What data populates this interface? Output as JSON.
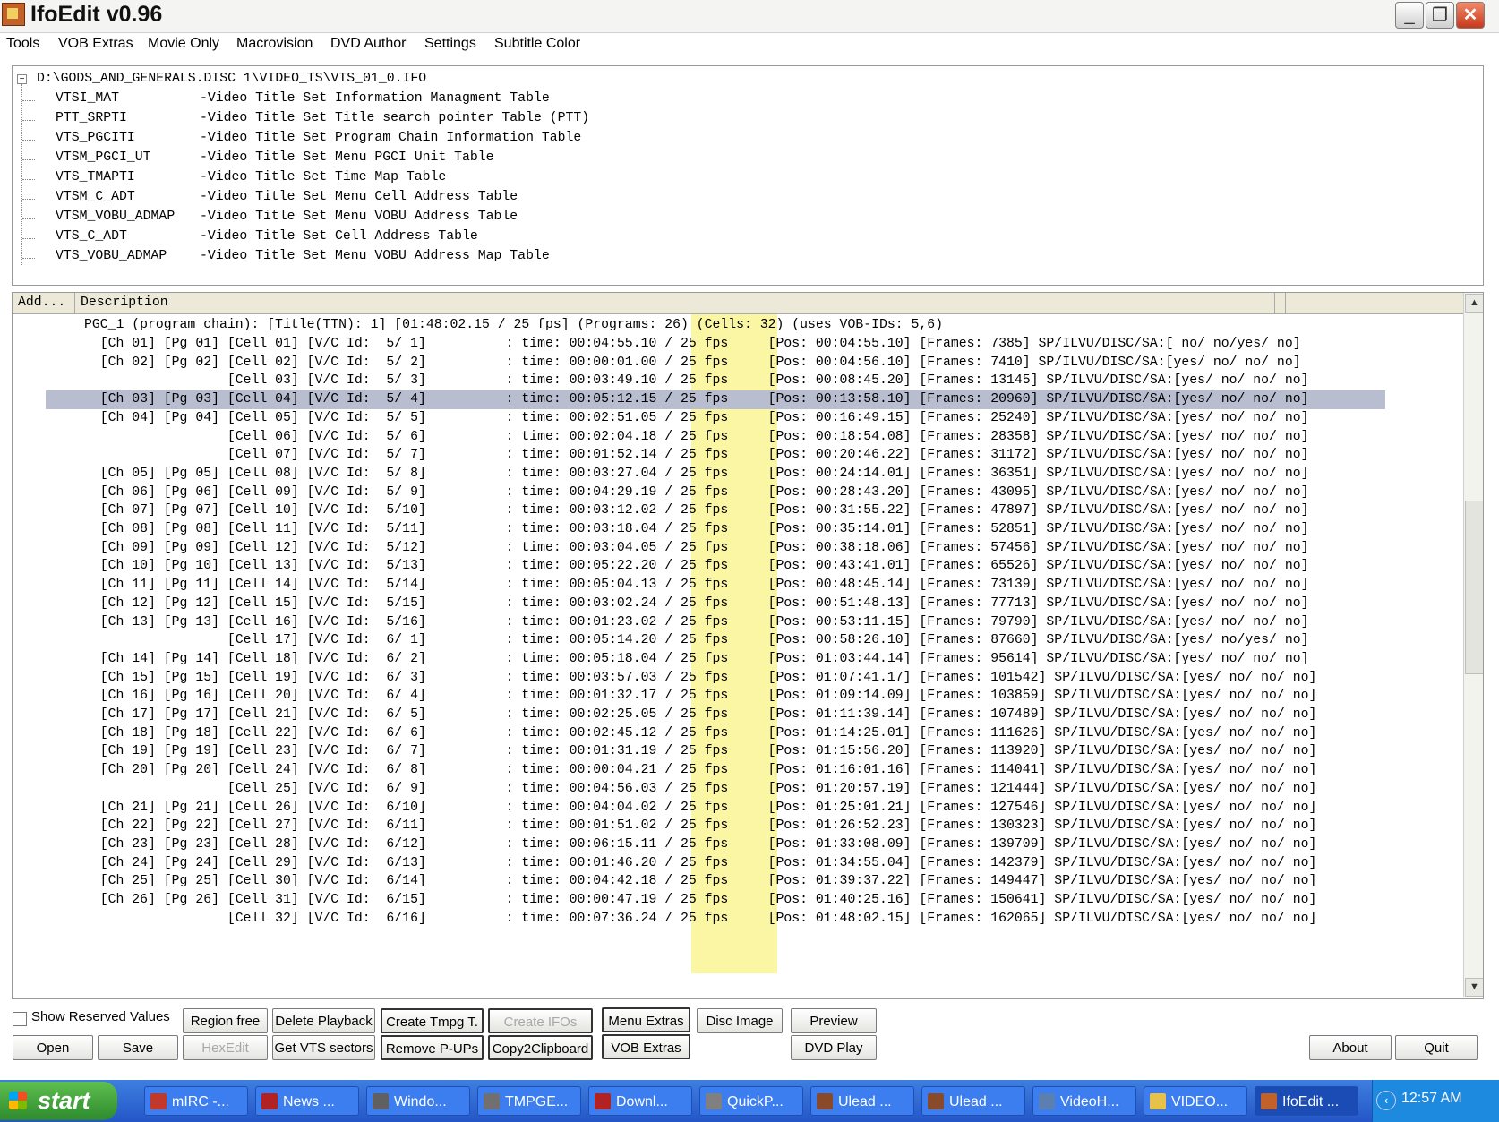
{
  "window": {
    "title": "IfoEdit v0.96",
    "minimize_glyph": "_",
    "maximize_glyph": "❐",
    "close_glyph": "✕"
  },
  "menu": [
    "Tools",
    "VOB Extras",
    "Movie Only",
    "Macrovision",
    "DVD Author",
    "Settings",
    "Subtitle Color"
  ],
  "tree": {
    "toggle": "−",
    "root": "D:\\GODS_AND_GENERALS.DISC 1\\VIDEO_TS\\VTS_01_0.IFO",
    "items": [
      {
        "name": "VTSI_MAT",
        "desc": "-Video Title Set Information Managment Table"
      },
      {
        "name": "PTT_SRPTI",
        "desc": "-Video Title Set Title search pointer Table (PTT)"
      },
      {
        "name": "VTS_PGCITI",
        "desc": "-Video Title Set Program Chain Information Table"
      },
      {
        "name": "VTSM_PGCI_UT",
        "desc": "-Video Title Set Menu PGCI Unit Table"
      },
      {
        "name": "VTS_TMAPTI",
        "desc": "-Video Title Set Time Map Table"
      },
      {
        "name": "VTSM_C_ADT",
        "desc": "-Video Title Set Menu Cell Address Table"
      },
      {
        "name": "VTSM_VOBU_ADMAP",
        "desc": "-Video Title Set Menu VOBU Address Table"
      },
      {
        "name": "VTS_C_ADT",
        "desc": "-Video Title Set Cell Address Table"
      },
      {
        "name": "VTS_VOBU_ADMAP",
        "desc": "-Video Title Set Menu VOBU Address Map Table"
      }
    ]
  },
  "list": {
    "headers": [
      "Add...",
      "Description"
    ],
    "pgc_header": "PGC_1 (program chain): [Title(TTN): 1] [01:48:02.15 / 25 fps] (Programs: 26) (Cells: 32) (uses VOB-IDs: 5,6)",
    "rows": [
      "  [Ch 01] [Pg 01] [Cell 01] [V/C Id:  5/ 1]          : time: 00:04:55.10 / 25 fps     [Pos: 00:04:55.10] [Frames: 7385] SP/ILVU/DISC/SA:[ no/ no/yes/ no]",
      "  [Ch 02] [Pg 02] [Cell 02] [V/C Id:  5/ 2]          : time: 00:00:01.00 / 25 fps     [Pos: 00:04:56.10] [Frames: 7410] SP/ILVU/DISC/SA:[yes/ no/ no/ no]",
      "                  [Cell 03] [V/C Id:  5/ 3]          : time: 00:03:49.10 / 25 fps     [Pos: 00:08:45.20] [Frames: 13145] SP/ILVU/DISC/SA:[yes/ no/ no/ no]",
      "  [Ch 03] [Pg 03] [Cell 04] [V/C Id:  5/ 4]          : time: 00:05:12.15 / 25 fps     [Pos: 00:13:58.10] [Frames: 20960] SP/ILVU/DISC/SA:[yes/ no/ no/ no]",
      "  [Ch 04] [Pg 04] [Cell 05] [V/C Id:  5/ 5]          : time: 00:02:51.05 / 25 fps     [Pos: 00:16:49.15] [Frames: 25240] SP/ILVU/DISC/SA:[yes/ no/ no/ no]",
      "                  [Cell 06] [V/C Id:  5/ 6]          : time: 00:02:04.18 / 25 fps     [Pos: 00:18:54.08] [Frames: 28358] SP/ILVU/DISC/SA:[yes/ no/ no/ no]",
      "                  [Cell 07] [V/C Id:  5/ 7]          : time: 00:01:52.14 / 25 fps     [Pos: 00:20:46.22] [Frames: 31172] SP/ILVU/DISC/SA:[yes/ no/ no/ no]",
      "  [Ch 05] [Pg 05] [Cell 08] [V/C Id:  5/ 8]          : time: 00:03:27.04 / 25 fps     [Pos: 00:24:14.01] [Frames: 36351] SP/ILVU/DISC/SA:[yes/ no/ no/ no]",
      "  [Ch 06] [Pg 06] [Cell 09] [V/C Id:  5/ 9]          : time: 00:04:29.19 / 25 fps     [Pos: 00:28:43.20] [Frames: 43095] SP/ILVU/DISC/SA:[yes/ no/ no/ no]",
      "  [Ch 07] [Pg 07] [Cell 10] [V/C Id:  5/10]          : time: 00:03:12.02 / 25 fps     [Pos: 00:31:55.22] [Frames: 47897] SP/ILVU/DISC/SA:[yes/ no/ no/ no]",
      "  [Ch 08] [Pg 08] [Cell 11] [V/C Id:  5/11]          : time: 00:03:18.04 / 25 fps     [Pos: 00:35:14.01] [Frames: 52851] SP/ILVU/DISC/SA:[yes/ no/ no/ no]",
      "  [Ch 09] [Pg 09] [Cell 12] [V/C Id:  5/12]          : time: 00:03:04.05 / 25 fps     [Pos: 00:38:18.06] [Frames: 57456] SP/ILVU/DISC/SA:[yes/ no/ no/ no]",
      "  [Ch 10] [Pg 10] [Cell 13] [V/C Id:  5/13]          : time: 00:05:22.20 / 25 fps     [Pos: 00:43:41.01] [Frames: 65526] SP/ILVU/DISC/SA:[yes/ no/ no/ no]",
      "  [Ch 11] [Pg 11] [Cell 14] [V/C Id:  5/14]          : time: 00:05:04.13 / 25 fps     [Pos: 00:48:45.14] [Frames: 73139] SP/ILVU/DISC/SA:[yes/ no/ no/ no]",
      "  [Ch 12] [Pg 12] [Cell 15] [V/C Id:  5/15]          : time: 00:03:02.24 / 25 fps     [Pos: 00:51:48.13] [Frames: 77713] SP/ILVU/DISC/SA:[yes/ no/ no/ no]",
      "  [Ch 13] [Pg 13] [Cell 16] [V/C Id:  5/16]          : time: 00:01:23.02 / 25 fps     [Pos: 00:53:11.15] [Frames: 79790] SP/ILVU/DISC/SA:[yes/ no/ no/ no]",
      "                  [Cell 17] [V/C Id:  6/ 1]          : time: 00:05:14.20 / 25 fps     [Pos: 00:58:26.10] [Frames: 87660] SP/ILVU/DISC/SA:[yes/ no/yes/ no]",
      "  [Ch 14] [Pg 14] [Cell 18] [V/C Id:  6/ 2]          : time: 00:05:18.04 / 25 fps     [Pos: 01:03:44.14] [Frames: 95614] SP/ILVU/DISC/SA:[yes/ no/ no/ no]",
      "  [Ch 15] [Pg 15] [Cell 19] [V/C Id:  6/ 3]          : time: 00:03:57.03 / 25 fps     [Pos: 01:07:41.17] [Frames: 101542] SP/ILVU/DISC/SA:[yes/ no/ no/ no]",
      "  [Ch 16] [Pg 16] [Cell 20] [V/C Id:  6/ 4]          : time: 00:01:32.17 / 25 fps     [Pos: 01:09:14.09] [Frames: 103859] SP/ILVU/DISC/SA:[yes/ no/ no/ no]",
      "  [Ch 17] [Pg 17] [Cell 21] [V/C Id:  6/ 5]          : time: 00:02:25.05 / 25 fps     [Pos: 01:11:39.14] [Frames: 107489] SP/ILVU/DISC/SA:[yes/ no/ no/ no]",
      "  [Ch 18] [Pg 18] [Cell 22] [V/C Id:  6/ 6]          : time: 00:02:45.12 / 25 fps     [Pos: 01:14:25.01] [Frames: 111626] SP/ILVU/DISC/SA:[yes/ no/ no/ no]",
      "  [Ch 19] [Pg 19] [Cell 23] [V/C Id:  6/ 7]          : time: 00:01:31.19 / 25 fps     [Pos: 01:15:56.20] [Frames: 113920] SP/ILVU/DISC/SA:[yes/ no/ no/ no]",
      "  [Ch 20] [Pg 20] [Cell 24] [V/C Id:  6/ 8]          : time: 00:00:04.21 / 25 fps     [Pos: 01:16:01.16] [Frames: 114041] SP/ILVU/DISC/SA:[yes/ no/ no/ no]",
      "                  [Cell 25] [V/C Id:  6/ 9]          : time: 00:04:56.03 / 25 fps     [Pos: 01:20:57.19] [Frames: 121444] SP/ILVU/DISC/SA:[yes/ no/ no/ no]",
      "  [Ch 21] [Pg 21] [Cell 26] [V/C Id:  6/10]          : time: 00:04:04.02 / 25 fps     [Pos: 01:25:01.21] [Frames: 127546] SP/ILVU/DISC/SA:[yes/ no/ no/ no]",
      "  [Ch 22] [Pg 22] [Cell 27] [V/C Id:  6/11]          : time: 00:01:51.02 / 25 fps     [Pos: 01:26:52.23] [Frames: 130323] SP/ILVU/DISC/SA:[yes/ no/ no/ no]",
      "  [Ch 23] [Pg 23] [Cell 28] [V/C Id:  6/12]          : time: 00:06:15.11 / 25 fps     [Pos: 01:33:08.09] [Frames: 139709] SP/ILVU/DISC/SA:[yes/ no/ no/ no]",
      "  [Ch 24] [Pg 24] [Cell 29] [V/C Id:  6/13]          : time: 00:01:46.20 / 25 fps     [Pos: 01:34:55.04] [Frames: 142379] SP/ILVU/DISC/SA:[yes/ no/ no/ no]",
      "  [Ch 25] [Pg 25] [Cell 30] [V/C Id:  6/14]          : time: 00:04:42.18 / 25 fps     [Pos: 01:39:37.22] [Frames: 149447] SP/ILVU/DISC/SA:[yes/ no/ no/ no]",
      "  [Ch 26] [Pg 26] [Cell 31] [V/C Id:  6/15]          : time: 00:00:47.19 / 25 fps     [Pos: 01:40:25.16] [Frames: 150641] SP/ILVU/DISC/SA:[yes/ no/ no/ no]",
      "                  [Cell 32] [V/C Id:  6/16]          : time: 00:07:36.24 / 25 fps     [Pos: 01:48:02.15] [Frames: 162065] SP/ILVU/DISC/SA:[yes/ no/ no/ no]"
    ],
    "selected_row": 3,
    "highlight_color": "#fbf6a3",
    "selection_color": "#b9bdd0"
  },
  "controls": {
    "show_reserved_label": "Show Reserved Values",
    "show_reserved_checked": false,
    "buttons": {
      "open": "Open",
      "save": "Save",
      "region_free": "Region free",
      "hexedit": "HexEdit",
      "delete_playback": "Delete Playback",
      "get_vts_sectors": "Get VTS sectors",
      "create_tmpg": "Create Tmpg T.",
      "remove_pups": "Remove P-UPs",
      "create_ifos": "Create IFOs",
      "copy2clipboard": "Copy2Clipboard",
      "menu_extras": "Menu Extras",
      "vob_extras": "VOB Extras",
      "disc_image": "Disc Image",
      "preview": "Preview",
      "dvd_play": "DVD Play",
      "about": "About",
      "quit": "Quit"
    }
  },
  "taskbar": {
    "start": "start",
    "tasks": [
      {
        "label": "mIRC -...",
        "icon_color": "#c0392b"
      },
      {
        "label": "News ...",
        "icon_color": "#b22222"
      },
      {
        "label": "Windo...",
        "icon_color": "#606060"
      },
      {
        "label": "TMPGE...",
        "icon_color": "#707070"
      },
      {
        "label": "Downl...",
        "icon_color": "#b22222"
      },
      {
        "label": "QuickP...",
        "icon_color": "#808080"
      },
      {
        "label": "Ulead ...",
        "icon_color": "#8a4a2a"
      },
      {
        "label": "Ulead ...",
        "icon_color": "#8a4a2a"
      },
      {
        "label": "VideoH...",
        "icon_color": "#5a7fb0"
      },
      {
        "label": "VIDEO...",
        "icon_color": "#e8c14a"
      },
      {
        "label": "IfoEdit ...",
        "icon_color": "#c2622a"
      }
    ],
    "active_task": 10,
    "tray_arrow": "‹",
    "clock": "12:57 AM"
  }
}
